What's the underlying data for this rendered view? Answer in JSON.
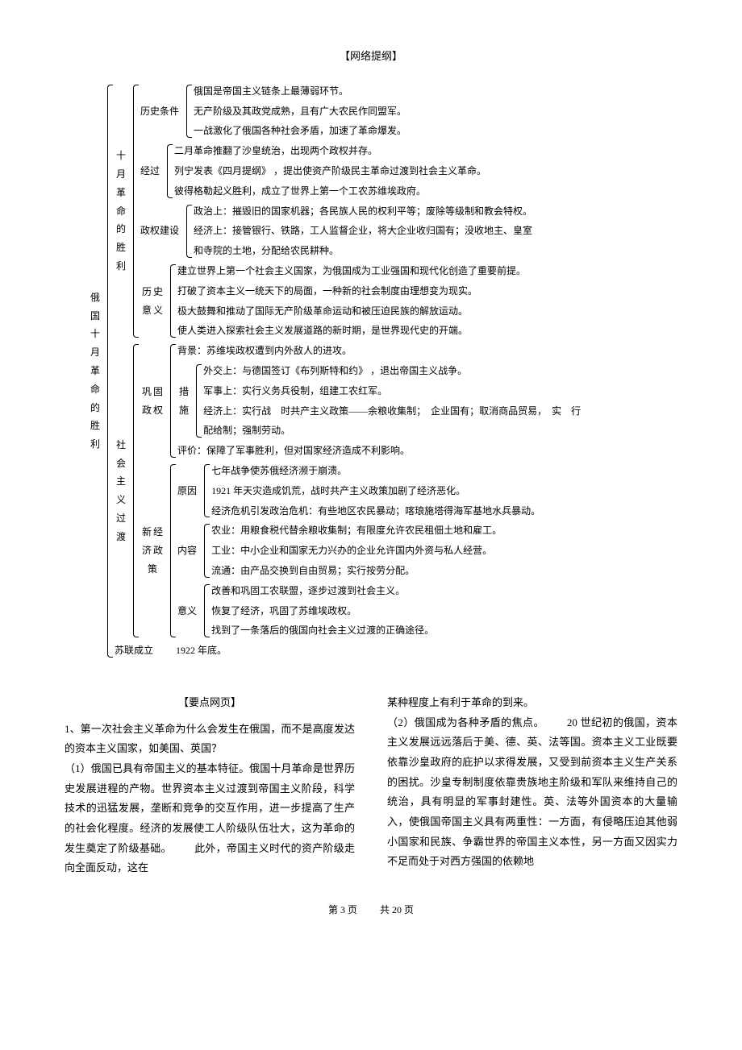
{
  "header": "【网络提纲】",
  "root": "俄\n国\n十\n月\n革\n命\n的\n胜\n利",
  "s1": {
    "label": "十\n月\n革\n命\n的\n胜\n利",
    "cond": {
      "label": "历史条件",
      "items": [
        "俄国是帝国主义链条上最薄弱环节。",
        "无产阶级及其政党成熟，且有广大农民作同盟军。",
        "一战激化了俄国各种社会矛盾，加速了革命爆发。"
      ]
    },
    "proc": {
      "label": "经过",
      "items": [
        "二月革命推翻了沙皇统治，出现两个政权并存。",
        "列宁发表《四月提纲》 ，提出使资产阶级民主革命过渡到社会主义革命。",
        "彼得格勒起义胜利，成立了世界上第一个工农苏维埃政府。"
      ]
    },
    "build": {
      "label": "政权建设",
      "items": [
        "政治上：摧毁旧的国家机器；各民族人民的权利平等；废除等级制和教会特权。",
        "经济上：接管银行、铁路，工人监督企业，将大企业收归国有；没收地主、皇室",
        "和寺院的土地，分配给农民耕种。"
      ]
    },
    "sig": {
      "label": "历史\n意义",
      "items": [
        "建立世界上第一个社会主义国家，为俄国成为工业强国和现代化创造了重要前提。",
        "打破了资本主义一统天下的局面，一种新的社会制度由理想变为现实。",
        "极大鼓舞和推动了国际无产阶级革命运动和被压迫民族的解放运动。",
        "使人类进入探索社会主义发展道路的新时期，是世界现代史的开端。"
      ]
    }
  },
  "s2": {
    "label": "社\n会\n主\n义\n过\n渡",
    "con": {
      "label": "巩固\n政权",
      "bg": "背景：苏维埃政权遭到内外敌人的进攻。",
      "meas": {
        "label": "措\n施",
        "items": [
          "外交上：与德国签订《布列斯特和约》 ，退出帝国主义战争。",
          "军事上：实行义务兵役制，组建工农红军。",
          "经济上：实行战　时共产主义政策——余粮收集制；　企业国有；取消商品贸易，　实　行",
          "配给制；强制劳动。"
        ]
      },
      "eval": "评价：保障了军事胜利，但对国家经济造成不利影响。"
    },
    "nep": {
      "label": "新经\n济政\n策",
      "cause": {
        "label": "原因",
        "items": [
          "七年战争使苏俄经济濒于崩溃。",
          "1921 年天灾造成饥荒，战时共产主义政策加剧了经济恶化。",
          "经济危机引发政治危机：有些地区农民暴动；喀琅施塔得海军基地水兵暴动。"
        ]
      },
      "content": {
        "label": "内容",
        "items": [
          "农业：用粮食税代替余粮收集制；有限度允许农民租佃土地和雇工。",
          "工业：中小企业和国家无力兴办的企业允许国内外资与私人经营。",
          "流通：由产品交换到自由贸易；实行按劳分配。"
        ]
      },
      "mean": {
        "label": "意义",
        "items": [
          "改善和巩固工农联盟，逐步过渡到社会主义。",
          "恢复了经济，巩固了苏维埃政权。",
          "找到了一条落后的俄国向社会主义过渡的正确途径。"
        ]
      }
    }
  },
  "ussr": {
    "label": "苏联成立",
    "value": "1922 年底。"
  },
  "yaodian": {
    "title": "【要点网页】",
    "q1": "1、第一次社会主义革命为什么会发生在俄国，而不是高度发达的资本主义国家，如美国、英国？",
    "p1a": "（1）俄国已具有帝国主义的基本特征。俄国十月革命是世界历史发展进程的产物。世界资本主义过渡到帝国主义阶段，科学技术的迅猛发展，垄断和竞争的交互作用，进一步提高了生产的社会化程度。经济的发展使工人阶级队伍壮大，这为革命的发生奠定了阶级基础。",
    "p1b": "此外，帝国主义时代的资产阶级走向全面反动，这在",
    "p2a": "某种程度上有利于革命的到来。",
    "p2b": "（2）俄国成为各种矛盾的焦点。",
    "p2c": "20 世纪初的俄国，资本主义发展远远落后于美、德、英、法等国。资本主义工业既要依靠沙皇政府的庇护以求得发展，又受到前资本主义生产关系的困扰。沙皇专制制度依靠贵族地主阶级和军队来维持自己的统治，具有明显的军事封建性。英、法等外国资本的大量输入，使俄国帝国主义具有两重性：一方面，有侵略压迫其他弱小国家和民族、争霸世界的帝国主义本性，另一方面又因实力不足而处于对西方强国的依赖地"
  },
  "footer": {
    "page": "第 3 页",
    "total": "共 20 页"
  }
}
